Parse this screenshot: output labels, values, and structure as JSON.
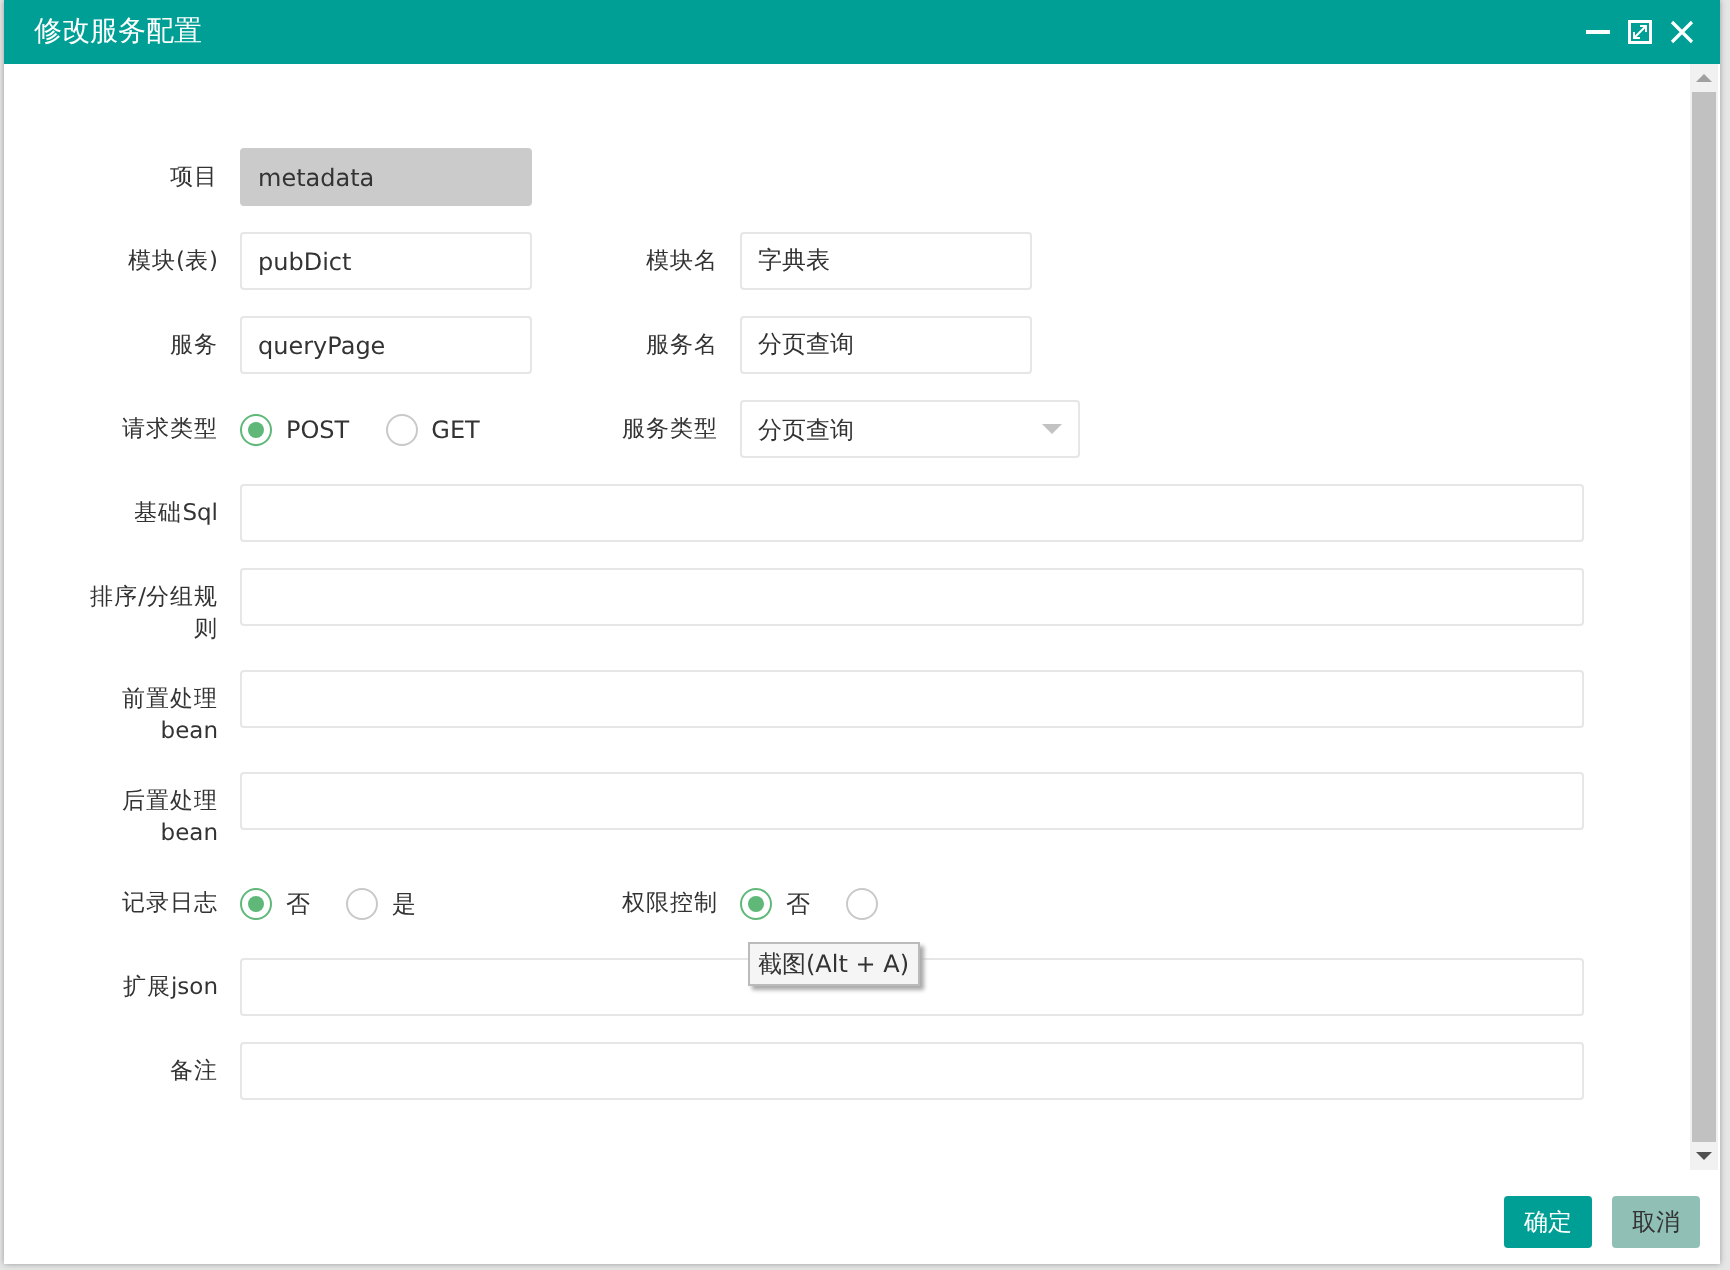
{
  "window": {
    "title": "修改服务配置"
  },
  "rows": [
    {
      "fields": [
        {
          "kind": "text",
          "label": "项目",
          "value": "metadata",
          "disabled": true
        }
      ]
    },
    {
      "fields": [
        {
          "kind": "text",
          "label": "模块(表)",
          "value": "pubDict",
          "disabled": false
        },
        {
          "kind": "text",
          "label": "模块名",
          "value": "字典表",
          "disabled": false
        }
      ]
    },
    {
      "fields": [
        {
          "kind": "text",
          "label": "服务",
          "value": "queryPage",
          "disabled": false
        },
        {
          "kind": "text",
          "label": "服务名",
          "value": "分页查询",
          "disabled": false
        }
      ]
    },
    {
      "fields": [
        {
          "kind": "radio",
          "label": "请求类型",
          "options": [
            {
              "label": "POST",
              "selected": true
            },
            {
              "label": "GET",
              "selected": false
            }
          ]
        },
        {
          "kind": "select",
          "label": "服务类型",
          "value": "分页查询"
        }
      ]
    },
    {
      "fields": [
        {
          "kind": "wide",
          "label": "基础Sql"
        }
      ]
    },
    {
      "fields": [
        {
          "kind": "wide",
          "label": "排序/分组规则"
        }
      ]
    },
    {
      "fields": [
        {
          "kind": "wide",
          "label": "前置处理bean"
        }
      ]
    },
    {
      "fields": [
        {
          "kind": "wide",
          "label": "后置处理bean"
        }
      ]
    },
    {
      "fields": [
        {
          "kind": "radio",
          "label": "记录日志",
          "options": [
            {
              "label": "否",
              "selected": true
            },
            {
              "label": "是",
              "selected": false
            }
          ]
        },
        {
          "kind": "radio",
          "label": "权限控制",
          "options": [
            {
              "label": "否",
              "selected": true
            },
            {
              "selected": false
            }
          ]
        }
      ]
    },
    {
      "fields": [
        {
          "kind": "wide",
          "label": "扩展json"
        }
      ]
    },
    {
      "fields": [
        {
          "kind": "wide",
          "label": "备注"
        }
      ]
    }
  ],
  "tooltip": "截图(Alt + A)",
  "buttons": [
    {
      "label": "确定",
      "kind": "primary"
    },
    {
      "label": "取消",
      "kind": "secondary"
    }
  ]
}
